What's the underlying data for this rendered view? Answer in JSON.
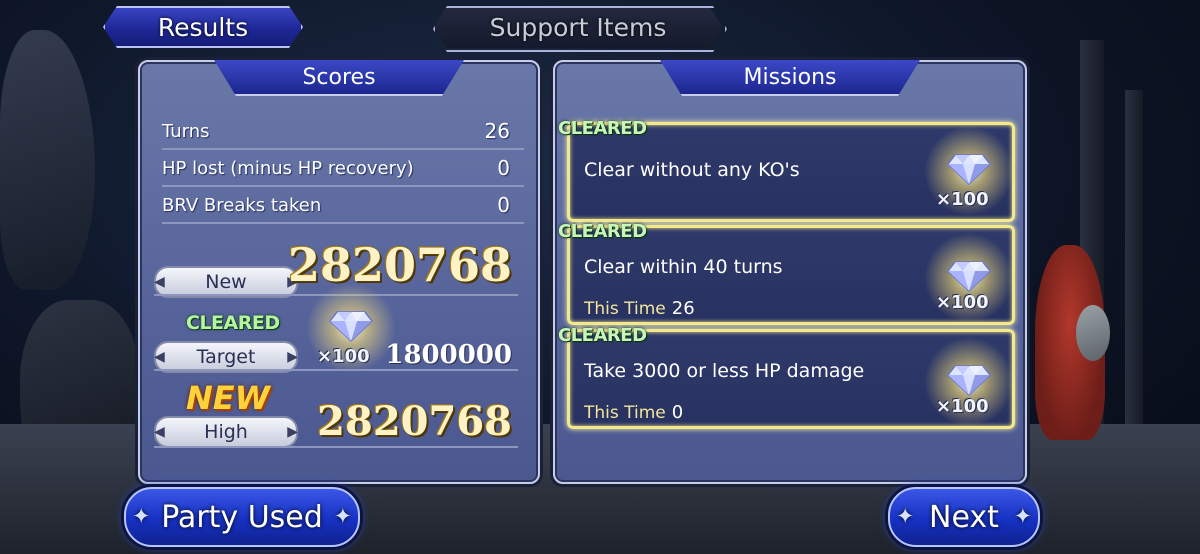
{
  "tabs": {
    "results": "Results",
    "support_items": "Support Items"
  },
  "scores": {
    "header": "Scores",
    "rows": [
      {
        "label": "Turns",
        "value": "26"
      },
      {
        "label": "HP lost (minus HP recovery)",
        "value": "0"
      },
      {
        "label": "BRV Breaks taken",
        "value": "0"
      }
    ],
    "new_label": "New",
    "new_value": "2820768",
    "cleared": "CLEARED",
    "target_label": "Target",
    "target_reward": "×100",
    "target_value": "1800000",
    "new_badge": "NEW",
    "high_label": "High",
    "high_value": "2820768"
  },
  "missions": {
    "header": "Missions",
    "items": [
      {
        "status": "CLEARED",
        "title": "Clear without any KO's",
        "sub_label": "",
        "sub_value": "",
        "reward": "×100"
      },
      {
        "status": "CLEARED",
        "title": "Clear within 40 turns",
        "sub_label": "This Time",
        "sub_value": "26",
        "reward": "×100"
      },
      {
        "status": "CLEARED",
        "title": "Take 3000 or less HP damage",
        "sub_label": "This Time",
        "sub_value": "0",
        "reward": "×100"
      }
    ]
  },
  "buttons": {
    "party_used": "Party Used",
    "next": "Next"
  },
  "colors": {
    "cleared_green": "#b6f5a0",
    "gold": "#ffd23a",
    "panel_blue": "#56639a",
    "button_blue": "#1631c3"
  },
  "icons": [
    "gem-icon",
    "arrow-left-icon",
    "arrow-right-icon"
  ]
}
